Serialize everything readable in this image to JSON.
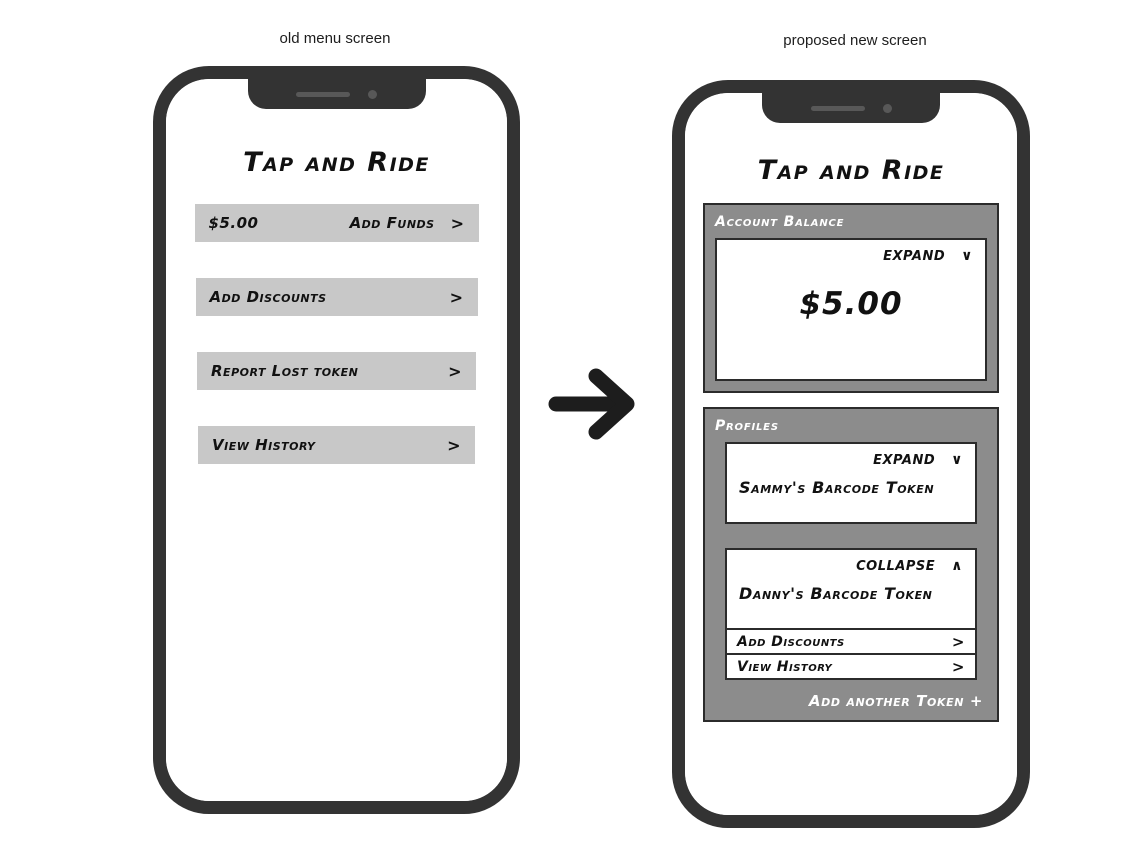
{
  "captions": {
    "left": "old menu screen",
    "right": "proposed new screen"
  },
  "colors": {
    "frame": "#333333",
    "button_gray": "#c8c8c8",
    "panel_gray": "#8c8c8c",
    "border_dark": "#2b2b2b",
    "card_white": "#ffffff",
    "text_black": "#111111",
    "text_white": "#ffffff"
  },
  "old_screen": {
    "app_title": "Tap and Ride",
    "menu_items": [
      {
        "left_label": "$5.00",
        "right_label": "Add Funds",
        "chevron": ">"
      },
      {
        "left_label": "Add Discounts",
        "right_label": "",
        "chevron": ">"
      },
      {
        "left_label": "Report Lost token",
        "right_label": "",
        "chevron": ">"
      },
      {
        "left_label": "View History",
        "right_label": "",
        "chevron": ">"
      }
    ]
  },
  "new_screen": {
    "app_title": "Tap and Ride",
    "account_balance": {
      "panel_title": "Account Balance",
      "toggle_label": "EXPAND",
      "toggle_caret": "∨",
      "amount": "$5.00"
    },
    "profiles": {
      "panel_title": "Profiles",
      "cards": [
        {
          "toggle_label": "EXPAND",
          "toggle_caret": "∨",
          "name": "Sammy's Barcode Token",
          "expanded": false,
          "actions": []
        },
        {
          "toggle_label": "COLLAPSE",
          "toggle_caret": "∧",
          "name": "Danny's Barcode Token",
          "expanded": true,
          "actions": [
            {
              "label": "Add Discounts",
              "chevron": ">"
            },
            {
              "label": "View History",
              "chevron": ">"
            }
          ]
        }
      ],
      "add_token_label": "Add another Token +"
    }
  },
  "arrow": {
    "icon": "arrow-right-icon",
    "direction": "right"
  }
}
